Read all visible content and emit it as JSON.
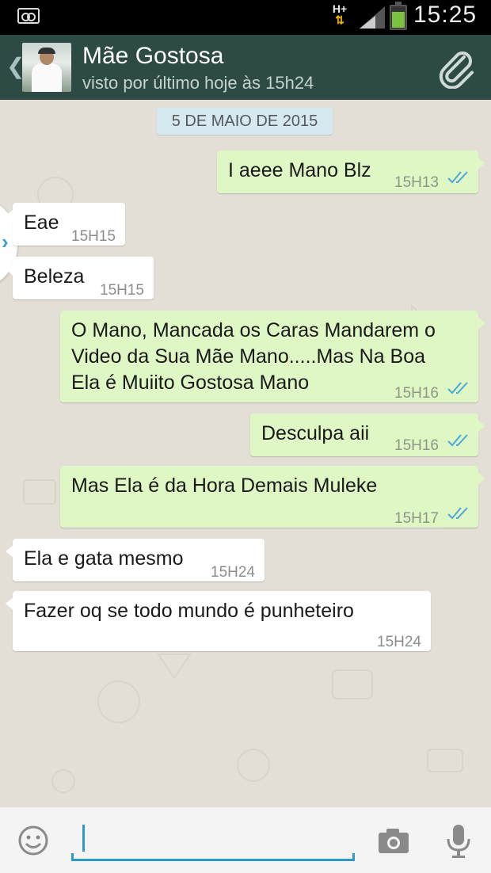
{
  "status_bar": {
    "network_type": "H+",
    "time": "15:25",
    "icons": [
      "voicemail-icon",
      "data-arrows-icon",
      "signal-icon",
      "battery-icon"
    ],
    "battery_level": 0.7
  },
  "header": {
    "back_icon": "chevron-left-icon",
    "contact_name": "Mãe Gostosa",
    "last_seen": "visto por último hoje às 15h24",
    "attach_icon": "paperclip-icon",
    "color": "#2d4a45"
  },
  "chat": {
    "date": "5 DE MAIO DE 2015",
    "messages": [
      {
        "direction": "out",
        "text": "I aeee Mano Blz",
        "time": "15H13",
        "status": "read-double-check"
      },
      {
        "direction": "in",
        "text": "Eae",
        "time": "15H15"
      },
      {
        "direction": "in",
        "text": "Beleza",
        "time": "15H15"
      },
      {
        "direction": "out",
        "lines": [
          "O Mano, Mancada os Caras Mandarem o",
          "Video da Sua Mãe Mano.....Mas Na Boa",
          "Ela é Muiito Gostosa Mano"
        ],
        "time": "15H16",
        "status": "read-double-check"
      },
      {
        "direction": "out",
        "text": "Desculpa aii",
        "time": "15H16",
        "status": "read-double-check"
      },
      {
        "direction": "out",
        "text": "Mas Ela é da Hora Demais Muleke",
        "time": "15H17",
        "status": "read-double-check"
      },
      {
        "direction": "in",
        "text": "Ela e gata mesmo",
        "time": "15H24"
      },
      {
        "direction": "in",
        "text": "Fazer oq se todo mundo é punheteiro",
        "time": "15H24"
      }
    ],
    "colors": {
      "outgoing": "#dff6c5",
      "incoming": "#ffffff",
      "background": "#e3dfd6",
      "ticks": "#4aa8d8"
    }
  },
  "input_bar": {
    "emoji_icon": "emoji-icon",
    "text_value": "",
    "camera_icon": "camera-icon",
    "mic_icon": "microphone-icon"
  }
}
